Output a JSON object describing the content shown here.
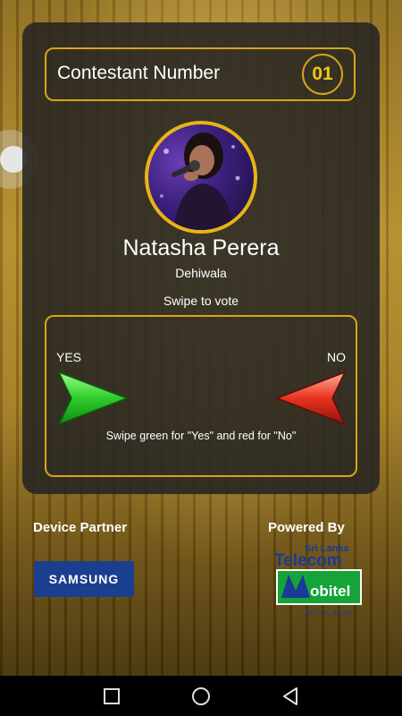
{
  "contestant": {
    "label": "Contestant Number",
    "number": "01",
    "name": "Natasha Perera",
    "location": "Dehiwala"
  },
  "vote": {
    "prompt": "Swipe to vote",
    "yes_label": "YES",
    "no_label": "NO",
    "instruction": "Swipe green for \"Yes\" and red for \"No\"",
    "yes_color": "#3fd93a",
    "no_color": "#e8331e"
  },
  "partners": {
    "device_title": "Device Partner",
    "device_logo_text": "SAMSUNG",
    "powered_title": "Powered By",
    "telecom_logo_text": {
      "line1": "Sri Lanka",
      "line2": "Telecom",
      "brand": "Mobitel",
      "tagline": "We Care. Always."
    }
  },
  "colors": {
    "accent_gold": "#d9a514",
    "card_bg": "#262422",
    "samsung_blue": "#1b3f8f"
  },
  "icons": {
    "nav_recents": "square-icon",
    "nav_home": "circle-icon",
    "nav_back": "triangle-back-icon"
  }
}
